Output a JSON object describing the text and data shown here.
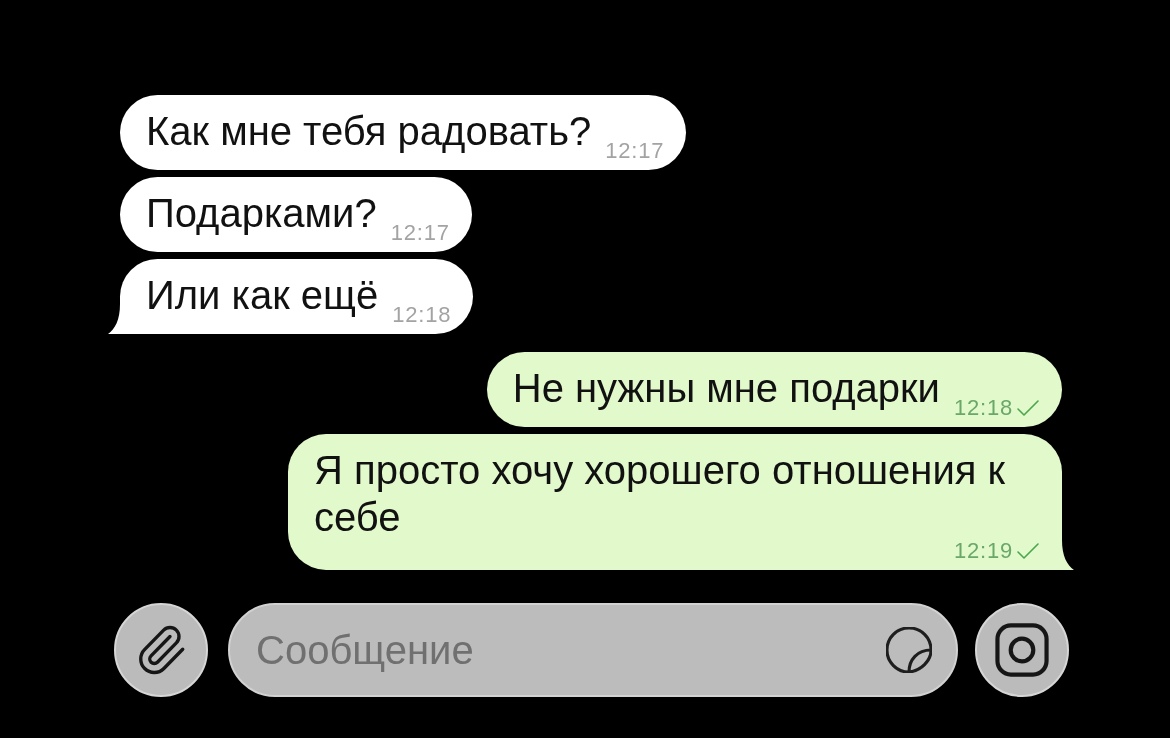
{
  "messages": [
    {
      "kind": "incoming",
      "text": "Как мне тебя радовать?",
      "time": "12:17",
      "tail": false
    },
    {
      "kind": "incoming",
      "text": "Подарками?",
      "time": "12:17",
      "tail": false
    },
    {
      "kind": "incoming",
      "text": "Или как ещё",
      "time": "12:18",
      "tail": true
    },
    {
      "kind": "outgoing",
      "text": "Не нужны мне подарки",
      "time": "12:18",
      "read": false,
      "tail": false
    },
    {
      "kind": "outgoing",
      "text": "Я просто хочу хорошего отношения к себе",
      "time": "12:19",
      "read": false,
      "tail": true
    }
  ],
  "composer": {
    "placeholder": "Сообщение"
  }
}
